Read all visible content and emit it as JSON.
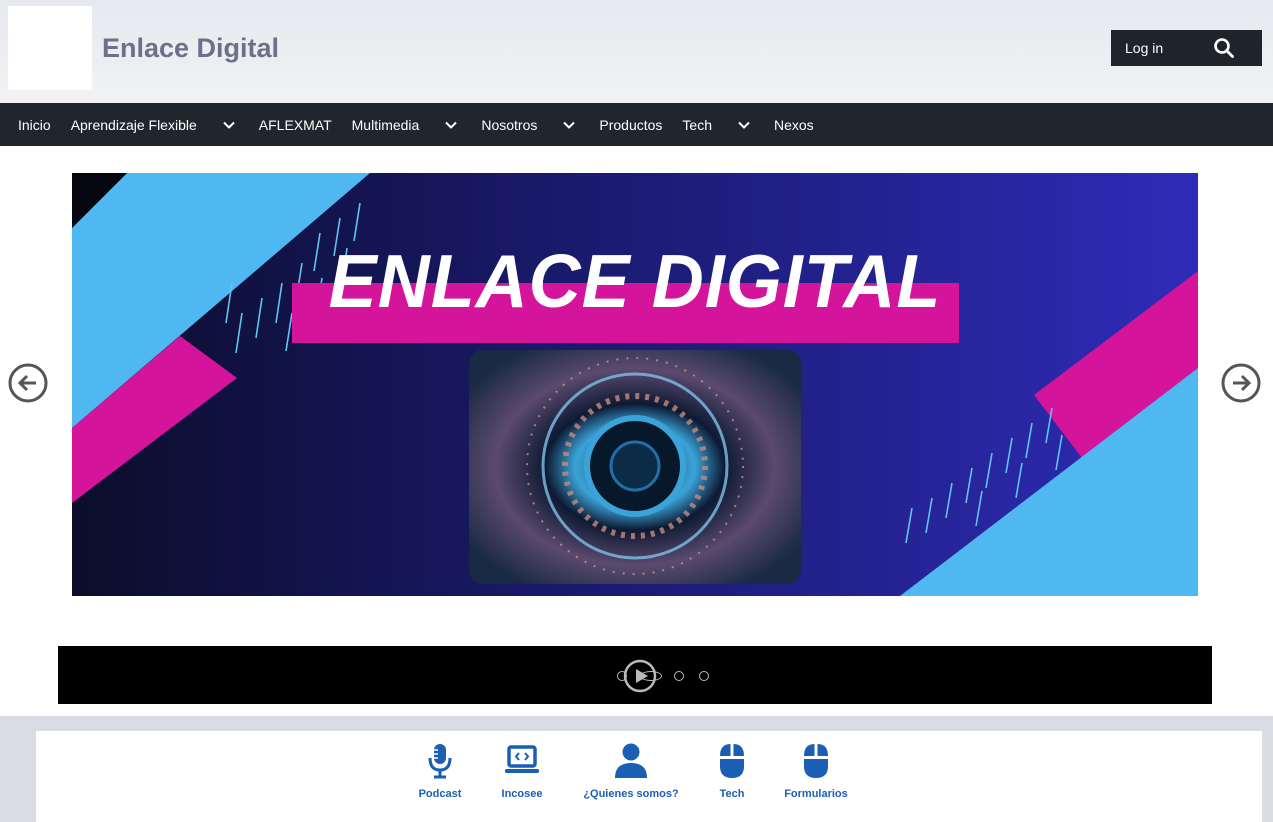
{
  "header": {
    "site_name": "Enlace Digital",
    "login_label": "Log in"
  },
  "nav": {
    "items": [
      {
        "label": "Inicio",
        "submenu": false
      },
      {
        "label": "Aprendizaje Flexible",
        "submenu": true
      },
      {
        "label": "AFLEXMAT",
        "submenu": false
      },
      {
        "label": "Multimedia",
        "submenu": true
      },
      {
        "label": "Nosotros",
        "submenu": true
      },
      {
        "label": "Productos",
        "submenu": false
      },
      {
        "label": "Tech",
        "submenu": true
      },
      {
        "label": "Nexos",
        "submenu": false
      }
    ]
  },
  "slider": {
    "slide_title": "ENLACE DIGITAL",
    "active_slide": 2,
    "slide_count": 4
  },
  "quick_links": [
    {
      "label": "Podcast",
      "icon": "microphone-icon"
    },
    {
      "label": "Incosee",
      "icon": "laptop-code-icon"
    },
    {
      "label": "¿Quienes somos?",
      "icon": "user-icon"
    },
    {
      "label": "Tech",
      "icon": "mouse-icon"
    },
    {
      "label": "Formularios",
      "icon": "mouse-icon"
    }
  ],
  "colors": {
    "nav_bg": "#1f262d",
    "link_blue": "#1a5fb4",
    "magenta": "#d4149b",
    "cyan": "#4fb8f0"
  }
}
